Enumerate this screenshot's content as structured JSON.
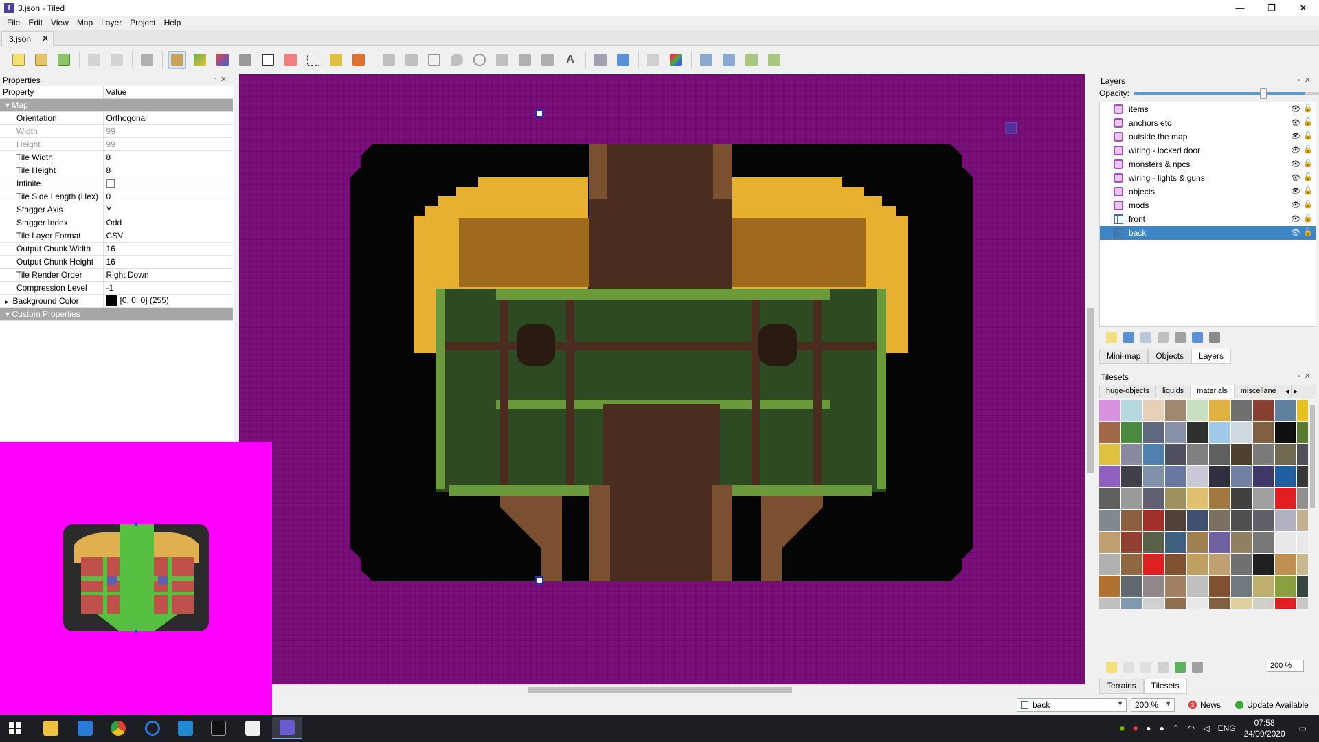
{
  "window": {
    "title": "3.json - Tiled",
    "app_icon_letter": "T",
    "controls": [
      "—",
      "❐",
      "✕"
    ]
  },
  "menus": [
    "File",
    "Edit",
    "View",
    "Map",
    "Layer",
    "Project",
    "Help"
  ],
  "document_tab": {
    "label": "3.json",
    "close": "✕"
  },
  "toolbar": {
    "icons": [
      "new-map-icon",
      "open-icon",
      "save-icon",
      "undo-icon",
      "redo-icon",
      "command-icon",
      "stamp-brush-icon",
      "terrain-brush-icon",
      "wang-brush-icon",
      "bucket-fill-icon",
      "shape-fill-icon",
      "eraser-icon",
      "rectangular-select-icon",
      "magic-wand-icon",
      "select-same-tile-icon",
      "select-objects-icon",
      "edit-polygons-icon",
      "insert-rectangle-icon",
      "insert-point-icon",
      "insert-ellipse-icon",
      "insert-polygon-icon",
      "insert-tile-icon",
      "insert-template-icon",
      "insert-text-icon",
      "random-mode-icon",
      "wang-fill-mode-icon",
      "flip-horizontal-icon",
      "flip-vertical-icon",
      "rotate-left-icon",
      "rotate-right-icon"
    ],
    "active_tool": "stamp-brush-icon"
  },
  "properties": {
    "panel_title": "Properties",
    "col_property": "Property",
    "col_value": "Value",
    "group_map": "Map",
    "rows": [
      {
        "name": "Orientation",
        "value": "Orthogonal"
      },
      {
        "name": "Width",
        "value": "99",
        "disabled": true
      },
      {
        "name": "Height",
        "value": "99",
        "disabled": true
      },
      {
        "name": "Tile Width",
        "value": "8"
      },
      {
        "name": "Tile Height",
        "value": "8"
      },
      {
        "name": "Infinite",
        "value": ""
      },
      {
        "name": "Tile Side Length (Hex)",
        "value": "0"
      },
      {
        "name": "Stagger Axis",
        "value": "Y"
      },
      {
        "name": "Stagger Index",
        "value": "Odd"
      },
      {
        "name": "Tile Layer Format",
        "value": "CSV"
      },
      {
        "name": "Output Chunk Width",
        "value": "16"
      },
      {
        "name": "Output Chunk Height",
        "value": "16"
      },
      {
        "name": "Tile Render Order",
        "value": "Right Down"
      },
      {
        "name": "Compression Level",
        "value": "-1"
      }
    ],
    "background_color_label": "Background Color",
    "background_color_value": "[0, 0, 0] (255)",
    "custom_properties_label": "Custom Properties"
  },
  "colors": {
    "canvas_bg": "#7a0e7a",
    "minimap_bg": "#ff00ff",
    "selection_blue": "#3d86c6"
  },
  "layers_panel": {
    "title": "Layers",
    "opacity_label": "Opacity:",
    "opacity_value": 0.72,
    "layers": [
      {
        "name": "items",
        "type": "object"
      },
      {
        "name": "anchors etc",
        "type": "object"
      },
      {
        "name": "outside the map",
        "type": "object"
      },
      {
        "name": "wiring - locked door",
        "type": "object"
      },
      {
        "name": "monsters & npcs",
        "type": "object"
      },
      {
        "name": "wiring - lights & guns",
        "type": "object"
      },
      {
        "name": "objects",
        "type": "object"
      },
      {
        "name": "mods",
        "type": "object"
      },
      {
        "name": "front",
        "type": "tile"
      },
      {
        "name": "back",
        "type": "tile",
        "selected": true
      }
    ],
    "tabs": [
      "Mini-map",
      "Objects",
      "Layers"
    ],
    "active_tab": "Layers"
  },
  "tilesets_panel": {
    "title": "Tilesets",
    "tabs": [
      "huge-objects",
      "liquids",
      "materials",
      "miscellane"
    ],
    "active_tab": "materials",
    "zoom": "200 %",
    "bottom_tabs": [
      "Terrains",
      "Tilesets"
    ],
    "active_bottom_tab": "Tilesets"
  },
  "statusbar": {
    "layer_combo": "back",
    "zoom_combo": "200 %",
    "news_count": "3",
    "news_label": "News",
    "update_label": "Update Available"
  },
  "taskbar": {
    "apps": [
      "start-icon",
      "file-explorer-icon",
      "mail-icon",
      "chrome-icon",
      "edge-icon",
      "vscode-icon",
      "terminal-icon",
      "game-icon",
      "tiled-icon"
    ],
    "lang": "ENG",
    "time": "07:58",
    "date": "24/09/2020"
  }
}
